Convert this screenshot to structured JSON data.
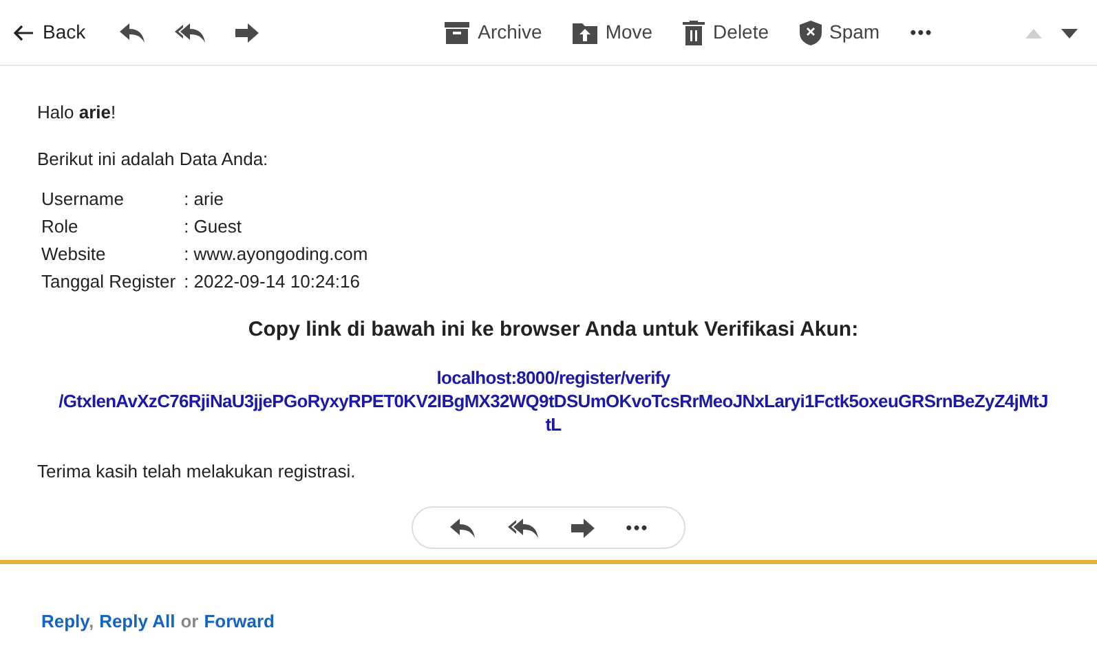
{
  "toolbar": {
    "back": "Back",
    "actions": [
      {
        "kind": "archive",
        "label": "Archive"
      },
      {
        "kind": "move",
        "label": "Move"
      },
      {
        "kind": "delete",
        "label": "Delete"
      },
      {
        "kind": "spam",
        "label": "Spam"
      }
    ],
    "more": "•••",
    "nav": [
      {
        "kind": "prev",
        "disabled": true
      },
      {
        "kind": "next",
        "disabled": false
      }
    ]
  },
  "body": {
    "greeting": "Halo **arie**!",
    "intro": "Berikut ini adalah Data Anda:",
    "details": [
      {
        "label": "Username",
        "value": ": arie"
      },
      {
        "label": "Role",
        "value": ": Guest"
      },
      {
        "label": "Website",
        "value": ": www.ayongoding.com"
      },
      {
        "label": "Tanggal Register",
        "value": ": 2022-09-14 10:24:16"
      }
    ],
    "heading": "Copy link di bawah ini ke browser Anda untuk Verifikasi Akun:",
    "link_lines": [
      "localhost:8000/register/verify",
      "/GtxIenAvXzC76RjiNaU3jjePGoRyxyRPET0KV2IBgMX32WQ9tDSUmOKvoTcsRrMeoJNxLaryi1Fctk5oxeuGRSrnBeZyZ4jMtJ",
      "tL"
    ],
    "thanks": "Terima kasih telah melakukan registrasi."
  },
  "inline_actions": {
    "more": "•••"
  },
  "footer": [
    {
      "kind": "link",
      "text": "Reply"
    },
    {
      "kind": "sep",
      "text": ","
    },
    {
      "kind": "link",
      "text": "Reply All"
    },
    {
      "kind": "sep",
      "text": "or"
    },
    {
      "kind": "link",
      "text": "Forward"
    }
  ]
}
